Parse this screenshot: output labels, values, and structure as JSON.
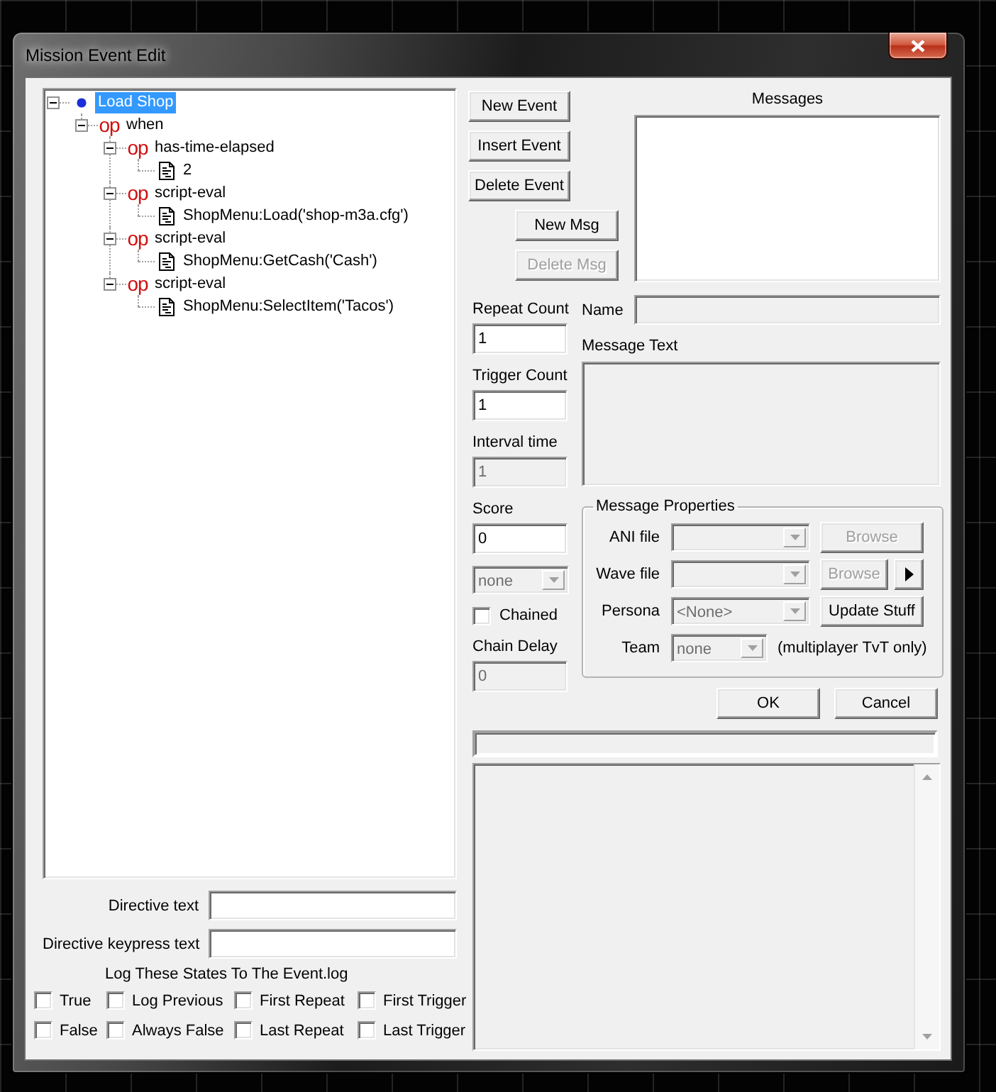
{
  "window": {
    "title": "Mission Event Edit"
  },
  "tree": [
    {
      "kind": "event",
      "label": "Load Shop",
      "selected": true,
      "expanded": true,
      "children": [
        {
          "kind": "operator",
          "glyph": "op",
          "label": "when",
          "selected": false,
          "expanded": true,
          "children": [
            {
              "kind": "operator",
              "glyph": "op",
              "label": "has-time-elapsed",
              "selected": false,
              "expanded": true,
              "children": [
                {
                  "kind": "value",
                  "label": "2",
                  "selected": false
                }
              ]
            },
            {
              "kind": "operator",
              "glyph": "op",
              "label": "script-eval",
              "selected": false,
              "expanded": true,
              "children": [
                {
                  "kind": "value",
                  "label": "ShopMenu:Load('shop-m3a.cfg')",
                  "selected": false
                }
              ]
            },
            {
              "kind": "operator",
              "glyph": "op",
              "label": "script-eval",
              "selected": false,
              "expanded": true,
              "children": [
                {
                  "kind": "value",
                  "label": "ShopMenu:GetCash('Cash')",
                  "selected": false
                }
              ]
            },
            {
              "kind": "operator",
              "glyph": "op",
              "label": "script-eval",
              "selected": false,
              "expanded": true,
              "children": [
                {
                  "kind": "value",
                  "label": "ShopMenu:SelectItem('Tacos')",
                  "selected": false
                }
              ]
            }
          ]
        }
      ]
    }
  ],
  "directive_fields": [
    {
      "label": "Directive text",
      "disabled": false
    },
    {
      "label": "Directive keypress text",
      "disabled": false
    }
  ],
  "log_states": {
    "title": "Log These States To The Event.log",
    "options": [
      {
        "label": "True",
        "checked": false
      },
      {
        "label": "Log Previous",
        "checked": false
      },
      {
        "label": "First Repeat",
        "checked": false
      },
      {
        "label": "First Trigger",
        "checked": false
      },
      {
        "label": "False",
        "checked": false
      },
      {
        "label": "Always False",
        "checked": false
      },
      {
        "label": "Last Repeat",
        "checked": false
      },
      {
        "label": "Last Trigger",
        "checked": false
      }
    ]
  },
  "event_buttons": [
    {
      "label": "New Event",
      "disabled": false
    },
    {
      "label": "Insert Event",
      "disabled": false
    },
    {
      "label": "Delete Event",
      "disabled": false
    }
  ],
  "message_buttons": [
    {
      "label": "New Msg",
      "disabled": false
    },
    {
      "label": "Delete Msg",
      "disabled": true
    }
  ],
  "messages": {
    "label": "Messages"
  },
  "event_settings": [
    {
      "kind": "text",
      "label": "Repeat Count",
      "value": "1",
      "disabled": false
    },
    {
      "kind": "text",
      "label": "Trigger Count",
      "value": "1",
      "disabled": false
    },
    {
      "kind": "text",
      "label": "Interval time",
      "value": "1",
      "disabled": true
    },
    {
      "kind": "text",
      "label": "Score",
      "value": "0",
      "disabled": false
    },
    {
      "kind": "combo",
      "value": "none",
      "disabled": true
    },
    {
      "kind": "check",
      "label": "Chained",
      "checked": false
    },
    {
      "kind": "text",
      "label": "Chain Delay",
      "value": "0",
      "disabled": true
    }
  ],
  "message_fields": [
    {
      "kind": "line",
      "label": "Name",
      "disabled": true
    },
    {
      "kind": "multiline",
      "label": "Message Text",
      "disabled": true
    }
  ],
  "message_properties": {
    "title": "Message Properties",
    "rows": [
      {
        "kind": "button",
        "label": "ANI file",
        "combo": {
          "disabled": true
        },
        "button": {
          "label": "Browse",
          "disabled": true
        }
      },
      {
        "kind": "button_play",
        "label": "Wave file",
        "combo": {
          "disabled": true
        },
        "button": {
          "label": "Browse",
          "disabled": true
        },
        "play": {
          "disabled": false
        }
      },
      {
        "kind": "button",
        "label": "Persona",
        "combo": {
          "value": "<None>",
          "disabled": true
        },
        "button": {
          "label": "Update Stuff",
          "disabled": false
        }
      },
      {
        "kind": "note",
        "label": "Team",
        "combo": {
          "value": "none",
          "disabled": true
        },
        "note": "(multiplayer TvT only)"
      }
    ]
  },
  "dialog_buttons": [
    {
      "label": "OK"
    },
    {
      "label": "Cancel"
    }
  ]
}
